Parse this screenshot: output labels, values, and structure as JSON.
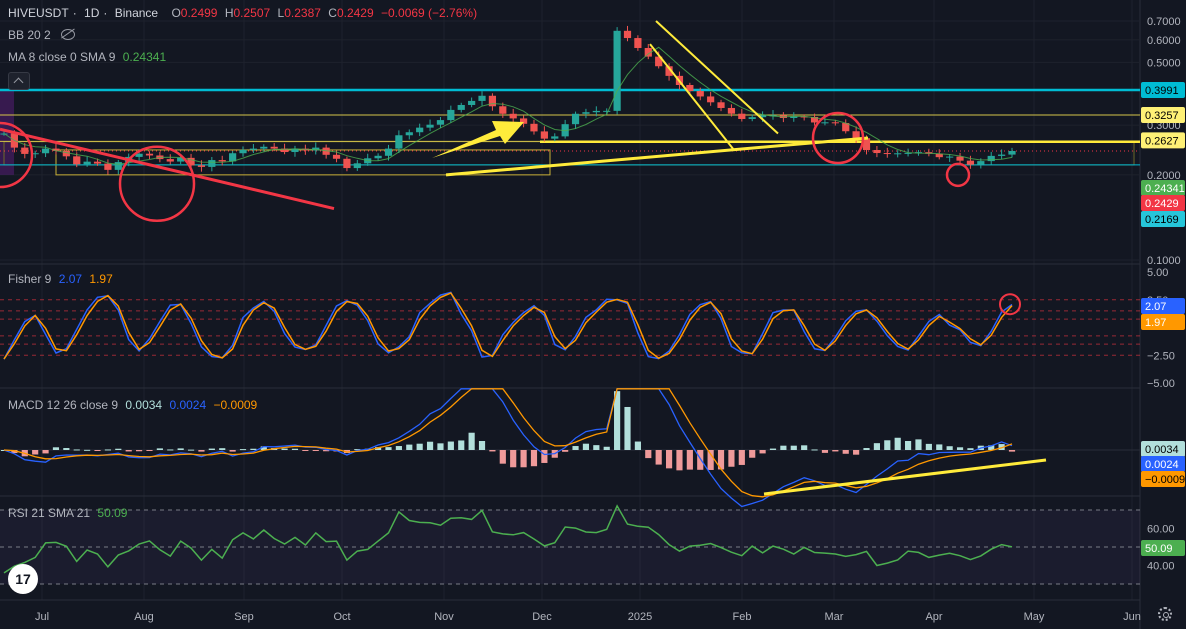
{
  "header": {
    "symbol": "HIVEUSDT",
    "interval": "1D",
    "exchange": "Binance",
    "separator": "·",
    "o_label": "O",
    "o_value": "0.2499",
    "h_label": "H",
    "h_value": "0.2507",
    "l_label": "L",
    "l_value": "0.2387",
    "c_label": "C",
    "c_value": "0.2429",
    "change": "−0.0069 (−2.76%)"
  },
  "indicators": {
    "bb_label": "BB 20 2",
    "ma_label": "MA 8 close 0 SMA 9",
    "ma_value": "0.24341",
    "fisher_label": "Fisher 9",
    "fisher_v1": "2.07",
    "fisher_v2": "1.97",
    "macd_label": "MACD 12 26 close 9",
    "macd_v1": "0.0034",
    "macd_v2": "0.0024",
    "macd_v3": "−0.0009",
    "rsi_label": "RSI 21 SMA 21",
    "rsi_value": "50.09"
  },
  "logo_text": "17",
  "colors": {
    "bg": "#131722",
    "up": "#26a69a",
    "down": "#ef5350",
    "grid": "#1e222d",
    "fisher": "#2962ff",
    "trigger": "#ff9800",
    "macd": "#2962ff",
    "signal": "#ff9800",
    "rsi": "#4caf50",
    "yellow": "#ffeb3b",
    "cyan": "#00bcd4",
    "red": "#f23645"
  },
  "chart_data": [
    {
      "type": "candlestick",
      "pane": "price",
      "series": [
        {
          "name": "HIVEUSDT",
          "close_values_sampled": [
            0.28,
            0.2497,
            0.2372,
            0.2385,
            0.2477,
            0.243,
            0.2326,
            0.218,
            0.2227,
            0.2192,
            0.2083,
            0.2219,
            0.2315,
            0.2376,
            0.2342,
            0.2274,
            0.2229,
            0.2297,
            0.216,
            0.2134,
            0.2256,
            0.2232,
            0.2385,
            0.2452,
            0.2477,
            0.2514,
            0.2477,
            0.2409,
            0.2476,
            0.2441,
            0.2497,
            0.2355,
            0.228,
            0.2114,
            0.2197,
            0.2289,
            0.2336,
            0.2477,
            0.2761,
            0.283,
            0.2938,
            0.3009,
            0.3124,
            0.3394,
            0.3533,
            0.3652,
            0.3808,
            0.3496,
            0.3289,
            0.3167,
            0.3031,
            0.2849,
            0.2686,
            0.2736,
            0.3022,
            0.3289,
            0.3331,
            0.3367,
            0.3368,
            0.6463,
            0.6092,
            0.5619,
            0.5238,
            0.4843,
            0.4478,
            0.4157,
            0.3958,
            0.3787,
            0.3611,
            0.3448,
            0.3291,
            0.3152,
            0.3199,
            0.3248,
            0.325,
            0.3178,
            0.3217,
            0.3204,
            0.3064,
            0.3068,
            0.305,
            0.2853,
            0.2696,
            0.2449,
            0.2389,
            0.2372,
            0.2384,
            0.2392,
            0.2406,
            0.2375,
            0.231,
            0.2321,
            0.2245,
            0.2173,
            0.2237,
            0.2334,
            0.2359,
            0.2429
          ]
        }
      ],
      "x_labels": [
        "Jul",
        "Aug",
        "Sep",
        "Oct",
        "Nov",
        "Dec",
        "2025",
        "Feb",
        "Mar",
        "Apr",
        "May",
        "Jun"
      ],
      "y_ticks": [
        "0.7000",
        "0.6000",
        "0.5000",
        "0.3000",
        "0.2000",
        "0.1000"
      ],
      "price_labels": [
        "0.3991",
        "0.3257",
        "0.2627",
        "0.24341",
        "0.2429",
        "0.2169"
      ],
      "y_scale": "log",
      "ylim": [
        0.1,
        0.72
      ]
    },
    {
      "type": "line",
      "pane": "fisher",
      "series": [
        {
          "name": "Fisher",
          "values_sampled": [
            -2.86,
            -1.1,
            0.53,
            1.09,
            -0.62,
            -2.3,
            -1.91,
            -0.16,
            1.59,
            2.72,
            2.86,
            1.58,
            -1.09,
            -2.11,
            -1.02,
            0.54,
            2.02,
            2.08,
            0.36,
            -1.74,
            -2.61,
            -2.72,
            -1.6,
            0.89,
            1.76,
            2.35,
            1.46,
            -0.55,
            -1.77,
            -1.98,
            -1.58,
            0.18,
            1.95,
            2.41,
            2.0,
            0.62,
            -1.48,
            -2.28,
            -1.74,
            -0.84,
            1.33,
            2.18,
            2.92,
            3.16,
            1.21,
            -0.29,
            -2.66,
            -2.52,
            -0.66,
            0.45,
            1.34,
            1.96,
            1.09,
            -1.54,
            -2.01,
            -0.8,
            0.91,
            1.59,
            2.54,
            2.49,
            2.17,
            -0.5,
            -2.62,
            -2.8,
            -2.13,
            -0.64,
            1.19,
            2.05,
            2.33,
            0.81,
            -1.71,
            -2.28,
            -2.36,
            -0.55,
            1.33,
            1.58,
            1.57,
            -0.37,
            -1.92,
            -2.07,
            -0.87,
            0.6,
            1.47,
            1.59,
            0.58,
            -0.73,
            -1.71,
            -2.03,
            -0.77,
            0.55,
            1.17,
            0.22,
            -0.21,
            -1.34,
            -1.63,
            -0.34,
            1.39,
            2.07
          ]
        },
        {
          "name": "Trigger",
          "values_sampled": [
            -2.84,
            -1.46,
            0.14,
            1.08,
            -0.07,
            -1.93,
            -2.09,
            -0.65,
            1.08,
            2.35,
            2.87,
            1.93,
            -0.44,
            -1.97,
            -1.36,
            0.07,
            1.59,
            2.12,
            0.85,
            -1.18,
            -2.43,
            -2.74,
            -1.94,
            0.2,
            1.58,
            2.23,
            1.75,
            0.0,
            -1.53,
            -1.96,
            -1.7,
            -0.33,
            1.44,
            2.33,
            2.16,
            1.02,
            -0.94,
            -2.12,
            -1.9,
            -1.1,
            0.72,
            1.95,
            2.71,
            3.11,
            1.72,
            0.14,
            -2.05,
            -2.6,
            -1.17,
            0.14,
            1.08,
            1.82,
            1.36,
            -0.82,
            -1.9,
            -1.15,
            0.43,
            1.39,
            2.28,
            2.53,
            2.28,
            0.25,
            -2.06,
            -2.77,
            -2.33,
            -1.06,
            0.67,
            1.82,
            2.27,
            1.24,
            -1.02,
            -2.12,
            -2.36,
            -1.05,
            0.8,
            1.51,
            1.59,
            0.16,
            -1.5,
            -2.05,
            -1.21,
            0.19,
            1.23,
            1.58,
            0.87,
            -0.36,
            -1.44,
            -1.95,
            -1.12,
            0.18,
            1.0,
            0.49,
            -0.1,
            -1.02,
            -1.56,
            -0.7,
            0.91,
            1.97
          ]
        }
      ],
      "y_ticks": [
        "5.00",
        "2.50",
        "−2.50",
        "−5.00"
      ],
      "ylim": [
        -5,
        5
      ]
    },
    {
      "type": "bar+line",
      "pane": "macd",
      "series": [
        {
          "name": "MACD",
          "values_sampled": [
            0.0,
            -0.0021,
            -0.0054,
            -0.0062,
            -0.0068,
            -0.0033,
            -0.0028,
            -0.0029,
            -0.0028,
            -0.0032,
            -0.0025,
            -0.0018,
            -0.0039,
            -0.0043,
            -0.0042,
            -0.0023,
            -0.0027,
            -0.0016,
            -0.0021,
            -0.0037,
            -0.0018,
            -0.0007,
            -0.0034,
            -0.0017,
            -0.001,
            0.0019,
            0.0018,
            0.0022,
            0.0027,
            0.0016,
            0.0015,
            0.0003,
            -0.0003,
            -0.0028,
            -0.0003,
            0.0004,
            0.0028,
            0.0041,
            0.0068,
            0.0104,
            0.0143,
            0.0201,
            0.023,
            0.0286,
            0.0345,
            0.0468,
            0.0459,
            0.0395,
            0.0267,
            0.0166,
            0.0084,
            0.0018,
            -0.0025,
            -0.002,
            0.0014,
            0.0066,
            0.0102,
            0.0114,
            0.0118,
            0.0686,
            0.0772,
            0.0613,
            0.0485,
            0.0369,
            0.0253,
            0.0135,
            0.0042,
            -0.0047,
            -0.0134,
            -0.0214,
            -0.0267,
            -0.0314,
            -0.0297,
            -0.0279,
            -0.0241,
            -0.0204,
            -0.018,
            -0.0154,
            -0.0171,
            -0.0197,
            -0.0192,
            -0.0218,
            -0.0236,
            -0.0191,
            -0.0145,
            -0.0105,
            -0.0061,
            -0.0057,
            -0.002,
            -0.0026,
            -0.0014,
            -0.0013,
            -0.0012,
            -0.0012,
            0.0011,
            0.0023,
            0.0045,
            0.0024
          ]
        },
        {
          "name": "Signal",
          "values_sampled": [
            0.0,
            -0.0004,
            -0.0019,
            -0.0037,
            -0.0049,
            -0.0048,
            -0.0039,
            -0.0032,
            -0.0029,
            -0.003,
            -0.0028,
            -0.0025,
            -0.0031,
            -0.0036,
            -0.0038,
            -0.0032,
            -0.003,
            -0.0025,
            -0.0023,
            -0.0028,
            -0.0026,
            -0.0017,
            -0.0025,
            -0.0022,
            -0.0017,
            -0.0001,
            0.0007,
            0.0014,
            0.002,
            0.0019,
            0.0017,
            0.001,
            0.0005,
            -0.0011,
            -0.0008,
            -0.0003,
            0.0012,
            0.0025,
            0.0046,
            0.0074,
            0.0108,
            0.0155,
            0.0193,
            0.0239,
            0.0292,
            0.0372,
            0.0409,
            0.0403,
            0.0343,
            0.0262,
            0.018,
            0.0108,
            0.0047,
            0.0023,
            0.0024,
            0.0044,
            0.0067,
            0.0087,
            0.01,
            0.0359,
            0.0533,
            0.0566,
            0.053,
            0.045,
            0.0355,
            0.0248,
            0.0151,
            0.0063,
            -0.0023,
            -0.0106,
            -0.0174,
            -0.0231,
            -0.0254,
            -0.026,
            -0.0249,
            -0.0228,
            -0.0204,
            -0.018,
            -0.0174,
            -0.0181,
            -0.0184,
            -0.0197,
            -0.021,
            -0.0202,
            -0.0183,
            -0.0159,
            -0.0129,
            -0.0107,
            -0.0079,
            -0.006,
            -0.0045,
            -0.0034,
            -0.0027,
            -0.0022,
            -0.0013,
            -0.0003,
            0.0012,
            0.0034
          ]
        },
        {
          "name": "Histogram",
          "values_sampled": [
            0.0,
            -0.0017,
            -0.0035,
            -0.0025,
            -0.0019,
            0.0015,
            0.0011,
            0.0003,
            0.0001,
            -0.0002,
            0.0003,
            0.0007,
            -0.0008,
            -0.0007,
            -0.0004,
            0.0009,
            0.0003,
            0.0009,
            0.0002,
            -0.0009,
            0.0008,
            0.001,
            -0.0009,
            0.0005,
            0.0007,
            0.002,
            0.0011,
            0.0008,
            0.0007,
            -0.0003,
            -0.0002,
            -0.0007,
            -0.0008,
            -0.0017,
            0.0005,
            0.0007,
            0.0016,
            0.0016,
            0.0022,
            0.003,
            0.0035,
            0.0046,
            0.0037,
            0.0047,
            0.0053,
            0.0096,
            0.005,
            -0.0008,
            -0.0076,
            -0.0096,
            -0.0096,
            -0.009,
            -0.0072,
            -0.0043,
            -0.001,
            0.0022,
            0.0035,
            0.0027,
            0.0018,
            0.0327,
            0.0239,
            0.0047,
            -0.0045,
            -0.0081,
            -0.0102,
            -0.0113,
            -0.0109,
            -0.011,
            -0.0111,
            -0.0108,
            -0.0093,
            -0.0083,
            -0.0043,
            -0.0019,
            0.0008,
            0.0024,
            0.0024,
            0.0026,
            0.0003,
            -0.0016,
            -0.0008,
            -0.0021,
            -0.0026,
            0.0011,
            0.0038,
            0.0054,
            0.0068,
            0.005,
            0.0059,
            0.0034,
            0.0031,
            0.0021,
            0.0015,
            0.001,
            0.0024,
            0.0026,
            0.0033,
            -0.0009
          ]
        }
      ]
    },
    {
      "type": "line",
      "pane": "rsi",
      "series": [
        {
          "name": "RSI",
          "values_sampled": [
            36.0,
            39.6,
            41.7,
            44.4,
            52.2,
            52.5,
            50.4,
            42.2,
            48.4,
            46.2,
            39.3,
            45.7,
            47.9,
            51.6,
            53.3,
            48.5,
            45.1,
            53.2,
            49.4,
            42.9,
            48.7,
            44.0,
            53.9,
            57.6,
            54.4,
            59.2,
            54.6,
            51.6,
            55.2,
            51.1,
            57.6,
            52.9,
            53.2,
            42.9,
            47.8,
            48.7,
            53.2,
            57.6,
            69.0,
            64.3,
            63.3,
            63.1,
            61.8,
            65.5,
            65.8,
            64.9,
            69.8,
            58.2,
            57.1,
            56.6,
            57.8,
            54.3,
            50.6,
            52.3,
            60.8,
            60.2,
            58.1,
            57.8,
            59.5,
            72.2,
            62.4,
            61.2,
            60.7,
            56.7,
            51.3,
            47.8,
            50.5,
            50.9,
            51.9,
            49.7,
            47.2,
            45.3,
            50.5,
            46.8,
            50.5,
            48.8,
            46.2,
            49.8,
            47.0,
            46.7,
            46.2,
            44.9,
            45.9,
            47.6,
            40.0,
            41.3,
            43.0,
            47.8,
            47.1,
            44.4,
            45.6,
            46.6,
            45.3,
            43.2,
            45.2,
            48.8,
            51.3,
            50.1
          ]
        }
      ],
      "y_ticks": [
        "60.00",
        "40.00"
      ],
      "ylim": [
        25,
        75
      ]
    }
  ]
}
